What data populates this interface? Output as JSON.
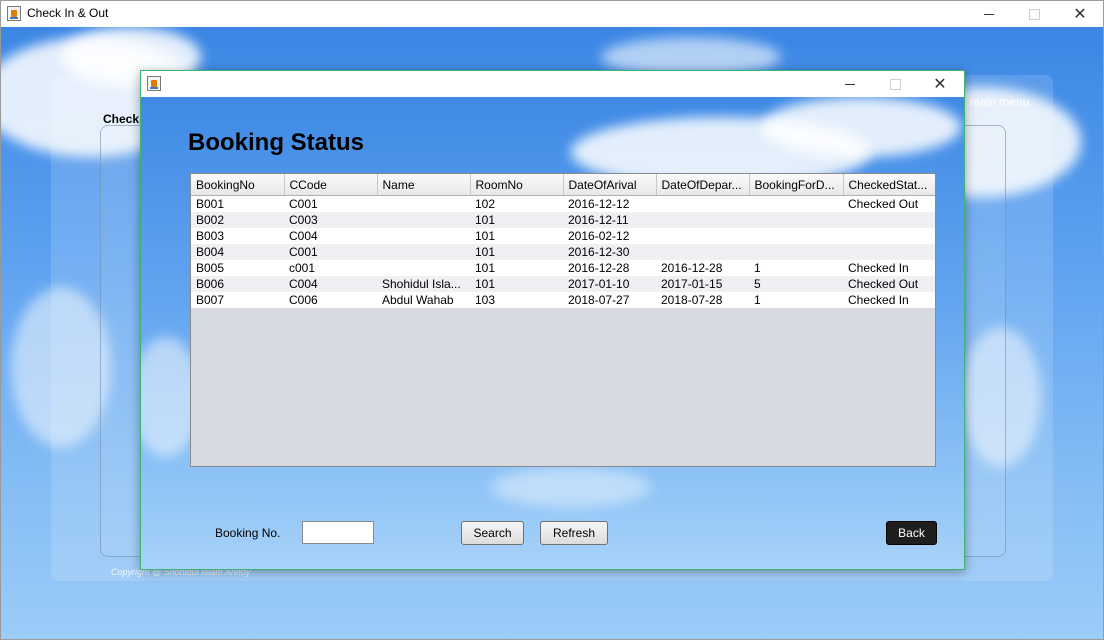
{
  "main_window": {
    "title": "Check In & Out",
    "check_label": "Check",
    "main_menu_label": "main menu",
    "copyright": "Copyright @ Shohidul Islam Annoy"
  },
  "dialog": {
    "heading": "Booking Status",
    "table": {
      "columns": [
        "BookingNo",
        "CCode",
        "Name",
        "RoomNo",
        "DateOfArival",
        "DateOfDepar...",
        "BookingForD...",
        "CheckedStat..."
      ],
      "rows": [
        [
          "B001",
          "C001",
          "",
          "102",
          "2016-12-12",
          "",
          "",
          "Checked Out"
        ],
        [
          "B002",
          "C003",
          "",
          "101",
          "2016-12-11",
          "",
          "",
          ""
        ],
        [
          "B003",
          "C004",
          "",
          "101",
          "2016-02-12",
          "",
          "",
          ""
        ],
        [
          "B004",
          "C001",
          "",
          "101",
          "2016-12-30",
          "",
          "",
          ""
        ],
        [
          "B005",
          "c001",
          "",
          "101",
          "2016-12-28",
          "2016-12-28",
          "1",
          "Checked In"
        ],
        [
          "B006",
          "C004",
          "Shohidul Isla...",
          "101",
          "2017-01-10",
          "2017-01-15",
          "5",
          "Checked Out"
        ],
        [
          "B007",
          "C006",
          "Abdul Wahab",
          "103",
          "2018-07-27",
          "2018-07-28",
          "1",
          "Checked In"
        ]
      ]
    },
    "booking_no_label": "Booking No.",
    "booking_no_value": "",
    "search_label": "Search",
    "refresh_label": "Refresh",
    "back_label": "Back"
  }
}
